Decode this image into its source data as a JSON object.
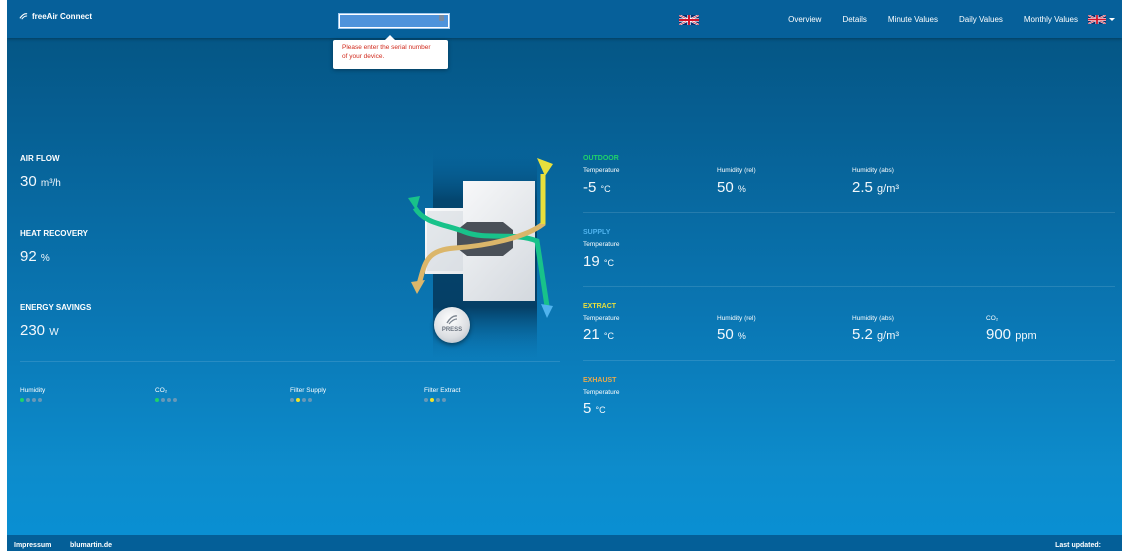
{
  "brand": {
    "name": "freeAir Connect",
    "icon": "freeair-logo-icon"
  },
  "serial_input": {
    "value": "",
    "placeholder": ""
  },
  "tooltip": {
    "line1": "Please enter the serial number",
    "line2": "of your device."
  },
  "nav": {
    "items": [
      "Overview",
      "Details",
      "Minute Values",
      "Daily Values",
      "Monthly Values"
    ]
  },
  "metrics": {
    "air_flow": {
      "label": "AIR FLOW",
      "value": "30",
      "unit": "m³/h"
    },
    "heat_recovery": {
      "label": "HEAT RECOVERY",
      "value": "92",
      "unit": "%"
    },
    "energy_savings": {
      "label": "ENERGY SAVINGS",
      "value": "230",
      "unit": "W"
    }
  },
  "status": [
    {
      "label": "Humidity",
      "level": 1,
      "color": "green"
    },
    {
      "label": "CO₂",
      "level": 1,
      "color": "green"
    },
    {
      "label": "Filter Supply",
      "level": 2,
      "color": "yellow"
    },
    {
      "label": "Filter Extract",
      "level": 2,
      "color": "yellow"
    }
  ],
  "sections": {
    "outdoor": {
      "title": "OUTDOOR",
      "color": "#1fd26a",
      "temp_label": "Temperature",
      "temp": "-5",
      "temp_unit": "°C",
      "hum_rel_label": "Humidity (rel)",
      "hum_rel": "50",
      "hum_rel_unit": "%",
      "hum_abs_label": "Humidity (abs)",
      "hum_abs": "2.5",
      "hum_abs_unit": "g/m³"
    },
    "supply": {
      "title": "SUPPLY",
      "color": "#4fb3ee",
      "temp_label": "Temperature",
      "temp": "19",
      "temp_unit": "°C"
    },
    "extract": {
      "title": "EXTRACT",
      "color": "#e8df3c",
      "temp_label": "Temperature",
      "temp": "21",
      "temp_unit": "°C",
      "hum_rel_label": "Humidity (rel)",
      "hum_rel": "50",
      "hum_rel_unit": "%",
      "hum_abs_label": "Humidity (abs)",
      "hum_abs": "5.2",
      "hum_abs_unit": "g/m³",
      "co2_label": "CO₂",
      "co2": "900",
      "co2_unit": "ppm"
    },
    "exhaust": {
      "title": "EXHAUST",
      "color": "#e5aa4f",
      "temp_label": "Temperature",
      "temp": "5",
      "temp_unit": "°C"
    }
  },
  "press_button": {
    "label": "PRESS"
  },
  "footer": {
    "impressum": "Impressum",
    "site": "blumartin.de",
    "last_updated": "Last updated:"
  },
  "colors": {
    "outdoor": "#1fd26a",
    "supply": "#4fb3ee",
    "extract": "#e8df3c",
    "exhaust": "#e5aa4f",
    "alert": "#d12b1e"
  }
}
